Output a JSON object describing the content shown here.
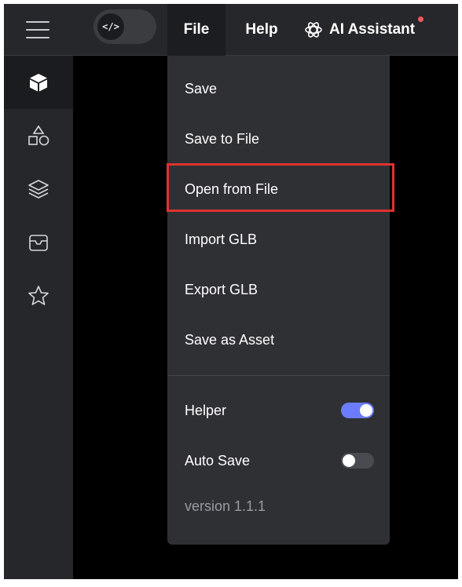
{
  "topbar": {
    "code_toggle_glyph": "</>",
    "menus": {
      "file": "File",
      "help": "Help",
      "ai_assistant": "AI Assistant"
    },
    "ai_notification_color": "#f25a5a"
  },
  "sidebar": {
    "items": [
      {
        "icon": "cube-icon",
        "active": true
      },
      {
        "icon": "shapes-icon",
        "active": false
      },
      {
        "icon": "layers-icon",
        "active": false
      },
      {
        "icon": "inbox-icon",
        "active": false
      },
      {
        "icon": "star-icon",
        "active": false
      }
    ]
  },
  "file_menu": {
    "items": [
      {
        "label": "Save"
      },
      {
        "label": "Save to File"
      },
      {
        "label": "Open from File",
        "highlighted": true
      },
      {
        "label": "Import GLB"
      },
      {
        "label": "Export GLB"
      },
      {
        "label": "Save as Asset"
      }
    ],
    "toggles": [
      {
        "label": "Helper",
        "on": true
      },
      {
        "label": "Auto Save",
        "on": false
      }
    ],
    "version": "version 1.1.1",
    "highlight_color": "#e03131",
    "toggle_on_color": "#6b7cff"
  }
}
